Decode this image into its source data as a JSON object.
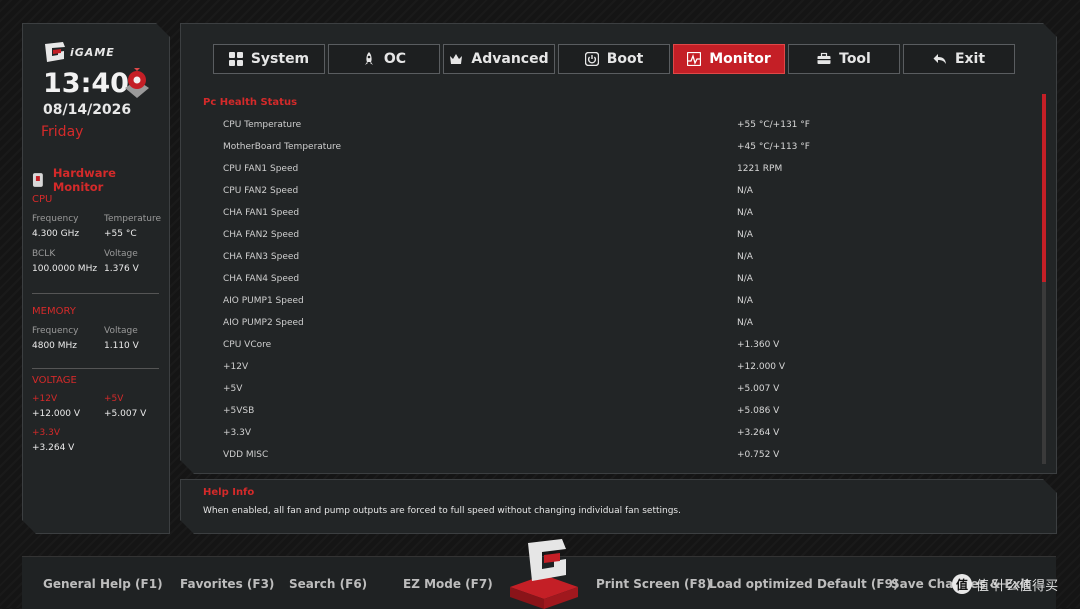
{
  "brand": {
    "logo_text": "iGAME"
  },
  "clock": {
    "time": "13:40",
    "date": "08/14/2026",
    "day": "Friday"
  },
  "hardware_monitor": {
    "title": "Hardware Monitor",
    "cpu": {
      "title": "CPU",
      "frequency_label": "Frequency",
      "frequency": "4.300 GHz",
      "temperature_label": "Temperature",
      "temperature": "+55 °C",
      "bclk_label": "BCLK",
      "bclk": "100.0000 MHz",
      "voltage_label": "Voltage",
      "voltage": "1.376 V"
    },
    "memory": {
      "title": "MEMORY",
      "frequency_label": "Frequency",
      "frequency": "4800 MHz",
      "voltage_label": "Voltage",
      "voltage": "1.110 V"
    },
    "voltage": {
      "title": "VOLTAGE",
      "v12_label": "+12V",
      "v12": "+12.000 V",
      "v5_label": "+5V",
      "v5": "+5.007 V",
      "v33_label": "+3.3V",
      "v33": "+3.264 V"
    }
  },
  "tabs": [
    {
      "label": "System",
      "icon": "grid-icon"
    },
    {
      "label": "OC",
      "icon": "rocket-icon"
    },
    {
      "label": "Advanced",
      "icon": "crown-icon"
    },
    {
      "label": "Boot",
      "icon": "power-icon"
    },
    {
      "label": "Monitor",
      "icon": "monitor-icon",
      "active": true
    },
    {
      "label": "Tool",
      "icon": "toolbox-icon"
    },
    {
      "label": "Exit",
      "icon": "back-arrow-icon"
    }
  ],
  "health": {
    "title": "Pc Health Status",
    "rows": [
      {
        "name": "CPU  Temperature",
        "value": "+55 °C/+131 °F"
      },
      {
        "name": "MotherBoard  Temperature",
        "value": "+45 °C/+113 °F"
      },
      {
        "name": "CPU FAN1 Speed",
        "value": "1221 RPM"
      },
      {
        "name": "CPU FAN2 Speed",
        "value": "N/A"
      },
      {
        "name": "CHA FAN1 Speed",
        "value": "N/A"
      },
      {
        "name": "CHA FAN2 Speed",
        "value": "N/A"
      },
      {
        "name": "CHA FAN3 Speed",
        "value": "N/A"
      },
      {
        "name": "CHA FAN4 Speed",
        "value": "N/A"
      },
      {
        "name": "AIO PUMP1 Speed",
        "value": "N/A"
      },
      {
        "name": "AIO PUMP2 Speed",
        "value": "N/A"
      },
      {
        "name": "CPU VCore",
        "value": "+1.360 V"
      },
      {
        "name": "+12V",
        "value": "+12.000 V"
      },
      {
        "name": "+5V",
        "value": "+5.007 V"
      },
      {
        "name": "+5VSB",
        "value": "+5.086 V"
      },
      {
        "name": "+3.3V",
        "value": "+3.264 V"
      },
      {
        "name": "VDD MISC",
        "value": "+0.752 V"
      }
    ]
  },
  "help": {
    "title": "Help Info",
    "text": "When enabled, all fan and pump outputs are forced to full speed without changing individual fan settings."
  },
  "footer": {
    "general_help": "General Help (F1)",
    "favorites": "Favorites (F3)",
    "search": "Search (F6)",
    "ez_mode": "EZ Mode (F7)",
    "print_screen": "Print Screen (F8)",
    "load_default": "Load optimized Default (F9)",
    "save_changes": "Save Changes & Exit"
  },
  "watermark": {
    "text": "值·什么值得买"
  },
  "colors": {
    "accent": "#c41f26",
    "panel": "#222526",
    "background": "#151515"
  }
}
